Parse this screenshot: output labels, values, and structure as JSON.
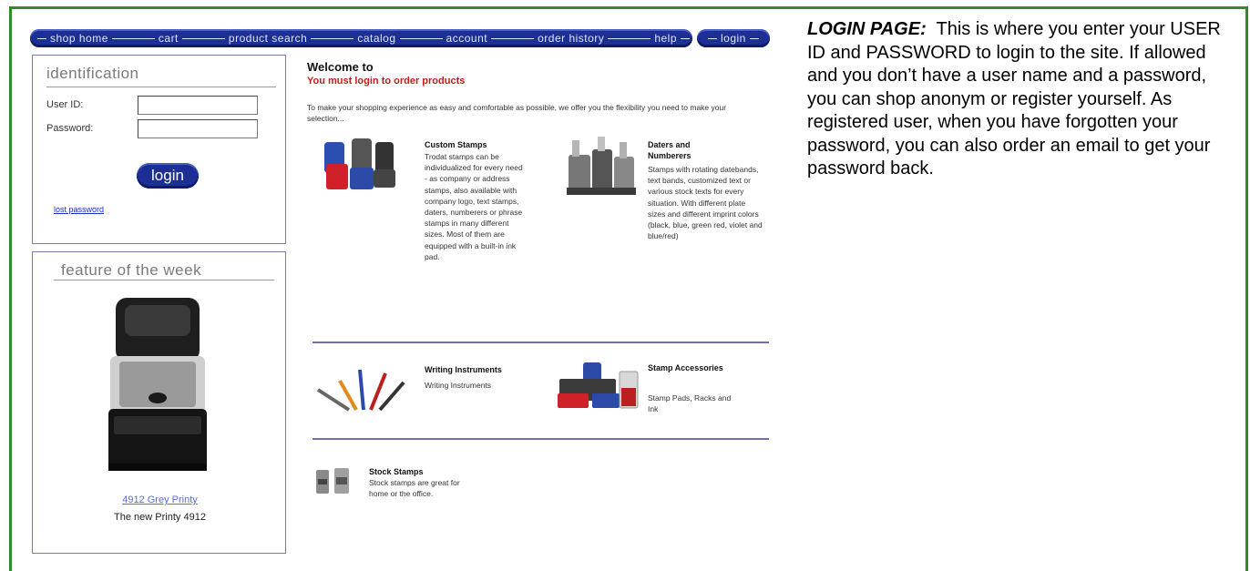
{
  "nav": {
    "items": [
      "shop home",
      "cart",
      "product search",
      "catalog",
      "account",
      "order history",
      "help"
    ],
    "login": "login"
  },
  "identification": {
    "title": "identification",
    "user_id_label": "User ID:",
    "user_id_value": "",
    "password_label": "Password:",
    "password_value": "",
    "login_button": "login",
    "lost_password": "lost password"
  },
  "feature": {
    "title": "feature of the week",
    "product_link": "4912 Grey Printy",
    "caption": "The new Printy 4912"
  },
  "main": {
    "welcome": "Welcome to",
    "must_login": "You must login to order products",
    "intro": "To make your shopping experience as easy and comfortable as possible, we offer you the flexibility you need to make your selection...",
    "products": [
      {
        "title": "Custom Stamps",
        "description": "Trodat stamps can be individualized for every need - as company or address stamps, also available with company logo, text stamps, daters, numberers or phrase stamps in many different sizes. Most of them are equipped with a built-in ink pad."
      },
      {
        "title": "Daters and Numberers",
        "description": "Stamps with rotating datebands, text bands, customized text or various stock texts for every situation. With different plate sizes and different imprint colors (black, blue, green red, violet and blue/red)"
      },
      {
        "title": "Writing Instruments",
        "description": "Writing Instruments"
      },
      {
        "title": "Stamp Accessories",
        "description": "Stamp Pads, Racks and Ink"
      },
      {
        "title": "Stock Stamps",
        "description": "Stock stamps are great for home or the office."
      }
    ]
  },
  "explanation": {
    "heading": "LOGIN PAGE:",
    "body": "This is where you enter your USER ID and PASSWORD to login to the site. If allowed and you don’t have a user name and a password, you can shop anonym or register yourself. As registered user, when you have forgotten your password, you can also order an email to get your password back."
  },
  "colors": {
    "frame": "#2e8b2e",
    "nav": "#1b2f94",
    "alert": "#c0201a",
    "link": "#1a2fcc"
  }
}
